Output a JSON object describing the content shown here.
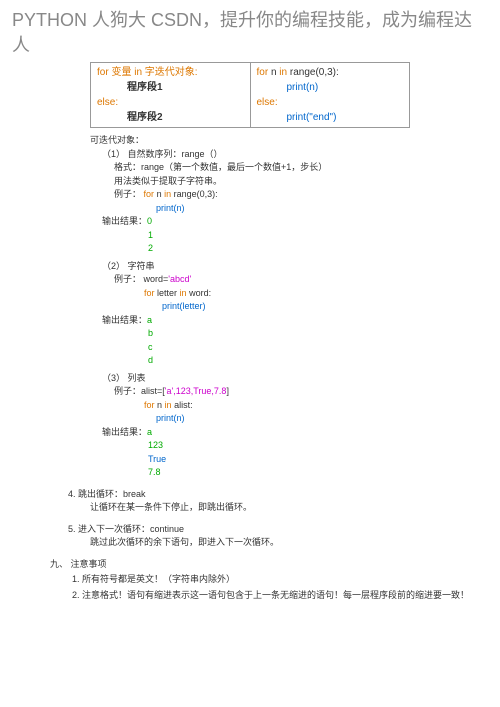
{
  "title": "PYTHON 人狗大 CSDN，提升你的编程技能，成为编程达人",
  "codeTable": {
    "left": {
      "line1_prefix": "for 变量 in 字迭代对象:",
      "seg1": "程序段1",
      "else_kw": "else:",
      "seg2": "程序段2"
    },
    "right": {
      "for_kw": "for",
      "nvar": "n",
      "in_kw": "in",
      "range_call": "range(0,3):",
      "print_n": "print(n)",
      "else_kw": "else:",
      "print_end": "print(\"end\")"
    }
  },
  "iterable": {
    "header": "可迭代对象：",
    "s1": {
      "label": "（1）   自然数序列：range（）",
      "format": "格式：range（第一个数值，最后一个数值+1，步长）",
      "usage": "用法类似于提取子字符串。",
      "ex_label": "例子：",
      "for_kw": "for",
      "n": "n",
      "in_kw": "in",
      "range": "range(0,3):",
      "print": "print(n)",
      "out_label": "输出结果：",
      "out": [
        "0",
        "1",
        "2"
      ]
    },
    "s2": {
      "label": "（2）   字符串",
      "ex_label": "例子：",
      "word_assign_l": "word=",
      "word_assign_r": "'abcd'",
      "for_kw": "for",
      "letter": "letter",
      "in_kw": "in",
      "word": "word:",
      "print": "print(letter)",
      "out_label": "输出结果：",
      "out": [
        "a",
        "b",
        "c",
        "d"
      ]
    },
    "s3": {
      "label": "（3）   列表",
      "ex_label": "例子：",
      "alist_l": "alist=[",
      "alist_items": "'a',123,True,7.8",
      "alist_r": "]",
      "for_kw": "for",
      "n": "n",
      "in_kw": "in",
      "alist": "alist:",
      "print": "print(n)",
      "out_label": "输出结果：",
      "out": [
        "a",
        "123",
        "True",
        "7.8"
      ]
    }
  },
  "item4": {
    "title": "4.   跳出循环：break",
    "desc": "让循环在某一条件下停止，即跳出循环。"
  },
  "item5": {
    "title": "5.   进入下一次循环：continue",
    "desc": "跳过此次循环的余下语句，即进入下一次循环。"
  },
  "sec9": {
    "header": "九、     注意事项",
    "i1": "1.   所有符号都是英文！（字符串内除外）",
    "i2": "2.   注意格式！语句有缩进表示这一语句包含于上一条无缩进的语句！每一层程序段前的缩进要一致！"
  }
}
